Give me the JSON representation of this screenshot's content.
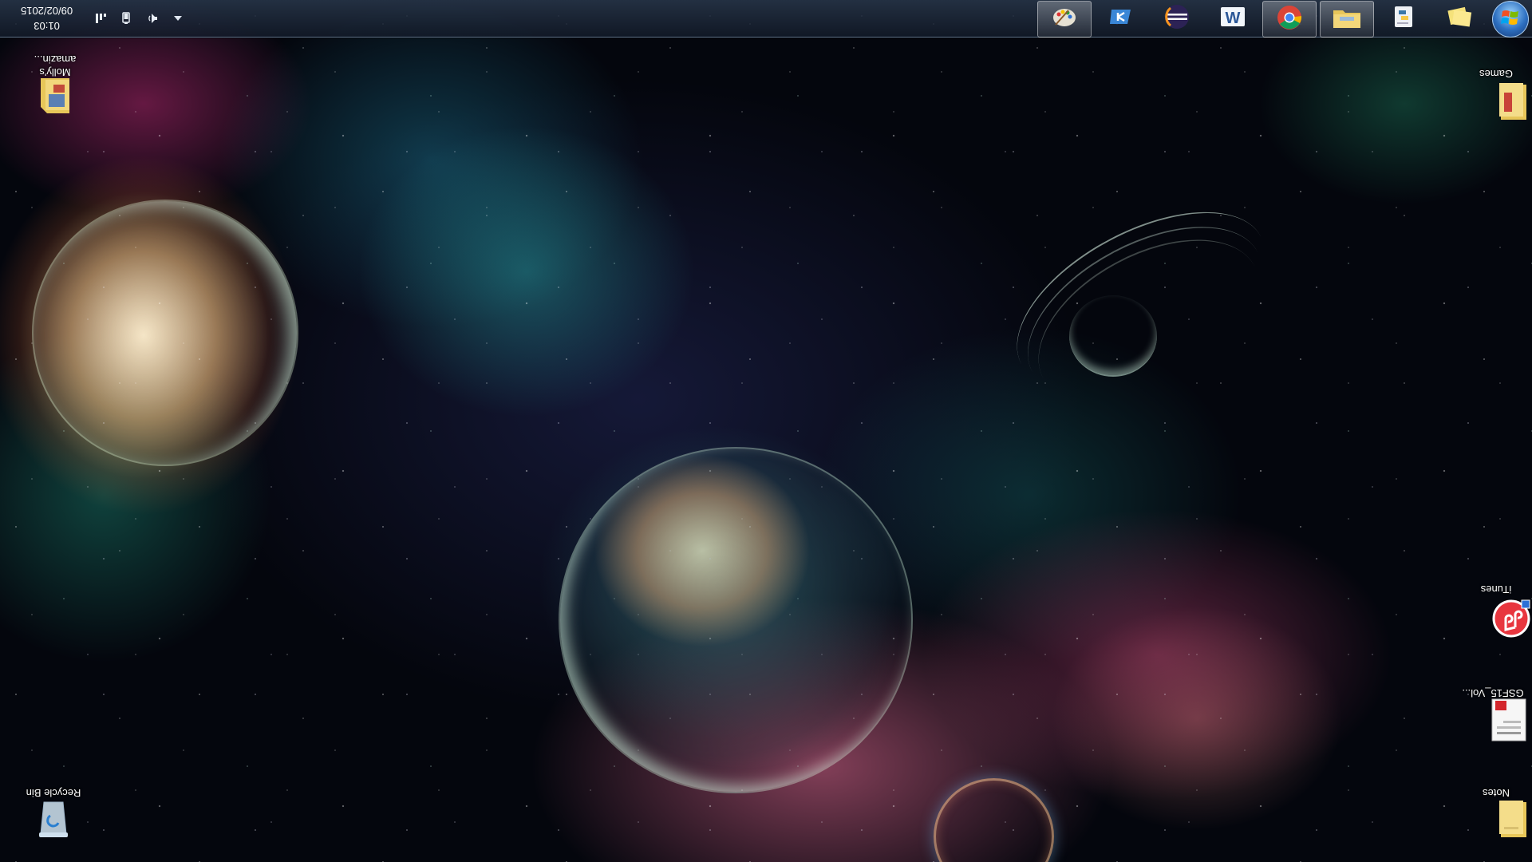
{
  "screen": {
    "orientation": "rotated-180",
    "wallpaper": "space nebula with planets"
  },
  "taskbar": {
    "clock": {
      "time": "01:03",
      "date": "09/02/2015"
    },
    "tray_icons": [
      "network-icon",
      "power-icon",
      "volume-icon",
      "show-hidden-icons"
    ],
    "start_button": "windows-orb-icon",
    "pinned_apps": [
      {
        "name": "paint-icon",
        "active": true
      },
      {
        "name": "k-app-icon",
        "active": false
      },
      {
        "name": "eclipse-icon",
        "active": false
      },
      {
        "name": "word-icon",
        "active": false
      },
      {
        "name": "chrome-icon",
        "active": true
      },
      {
        "name": "file-explorer-icon",
        "active": true
      },
      {
        "name": "python-icon",
        "active": false
      },
      {
        "name": "sticky-notes-icon",
        "active": false
      }
    ]
  },
  "desktop": {
    "icons": [
      {
        "id": "recycle-bin",
        "label": "Recycle Bin",
        "icon": "recycle-bin-icon"
      },
      {
        "id": "mollys",
        "label": "Molly's amazin...",
        "icon": "folder-icon"
      },
      {
        "id": "games",
        "label": "Games",
        "icon": "folder-icon"
      },
      {
        "id": "itunes",
        "label": "iTunes",
        "icon": "itunes-icon"
      },
      {
        "id": "gsf",
        "label": "GSF15_Vol...",
        "icon": "pdf-document-icon"
      },
      {
        "id": "notes",
        "label": "Notes",
        "icon": "folder-icon"
      }
    ]
  },
  "colors": {
    "taskbar": "#1b2636",
    "start_orb": "#2d6fc0",
    "label_text": "#ffffff"
  }
}
